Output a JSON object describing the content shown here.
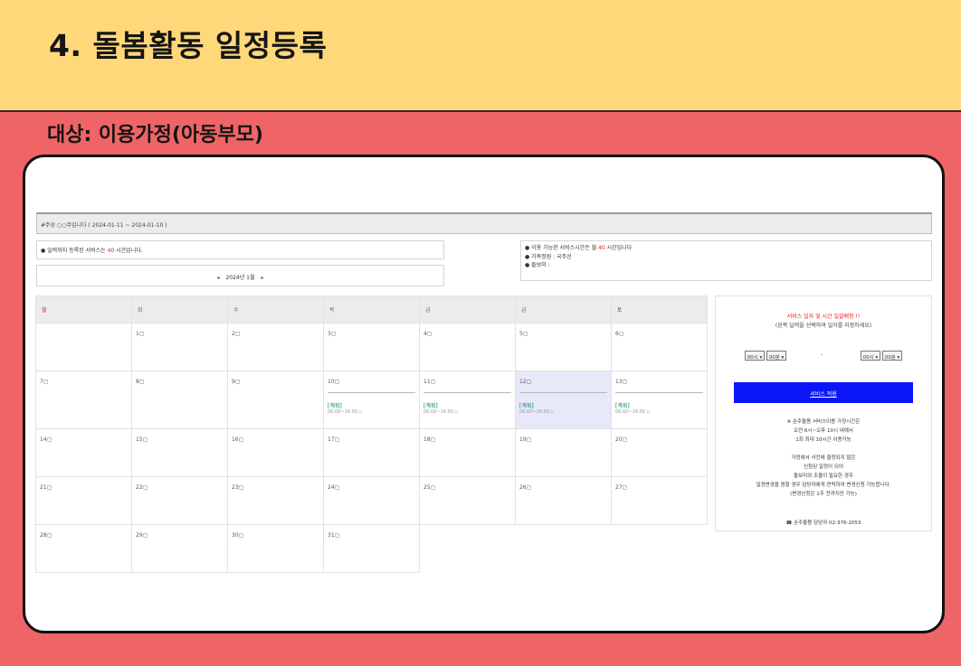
{
  "slide": {
    "title": "4. 돌봄활동 일정등록",
    "subtitle": "대상: 이용가정(아동부모)"
  },
  "screen": {
    "week_bar": "#주상 ○○주입니다 ( 2024-01-11 ~ 2024-01-10 )",
    "notice_left": {
      "prefix": "● 일력까지 등록된 서비스는 ",
      "hours": "40",
      "suffix": " 시간입니다."
    },
    "month_nav": {
      "prev": "◂",
      "label": "2024년 1월",
      "next": "▸"
    },
    "notice_right": {
      "line1_prefix": "● 이용 가능한 서비스시간은 월 ",
      "line1_hours": "40",
      "line1_suffix": " 시간입니다",
      "line2": "● 가족정원 : 국주선",
      "line3": "● 돌보미 :"
    },
    "weekdays": [
      "월",
      "화",
      "수",
      "목",
      "금",
      "금",
      "토"
    ],
    "weeks": [
      [
        {
          "day": ""
        },
        {
          "day": "1▢"
        },
        {
          "day": "2▢"
        },
        {
          "day": "3▢"
        },
        {
          "day": "4▢"
        },
        {
          "day": "5▢"
        },
        {
          "day": "6▢"
        }
      ],
      [
        {
          "day": "7▢"
        },
        {
          "day": "8▢"
        },
        {
          "day": "9▢"
        },
        {
          "day": "10▢",
          "type": "[계획]",
          "time": "06:00~16:00 ▫"
        },
        {
          "day": "11▢",
          "type": "[계획]",
          "time": "06:00~16:00 ▫"
        },
        {
          "day": "12▢",
          "type": "[계획]",
          "time": "06:00~16:00 ▫",
          "selected": true
        },
        {
          "day": "13▢",
          "type": "[계획]",
          "time": "06:00~16:00 ▫"
        }
      ],
      [
        {
          "day": "14▢"
        },
        {
          "day": "15▢"
        },
        {
          "day": "16▢"
        },
        {
          "day": "17▢"
        },
        {
          "day": "18▢"
        },
        {
          "day": "19▢"
        },
        {
          "day": "20▢"
        }
      ],
      [
        {
          "day": "21▢"
        },
        {
          "day": "22▢"
        },
        {
          "day": "23▢"
        },
        {
          "day": "24▢"
        },
        {
          "day": "25▢"
        },
        {
          "day": "26▢"
        },
        {
          "day": "27▢"
        }
      ],
      [
        {
          "day": "28▢"
        },
        {
          "day": "29▢"
        },
        {
          "day": "30▢"
        },
        {
          "day": "31▢"
        }
      ]
    ],
    "side_panel": {
      "title": "서비스 일자 및 시간 일괄배정 !!",
      "subtitle": "(왼쪽 달력을 선택하여 일자를 지정하세요)",
      "start_hour": "00시 ▾",
      "start_min": "00분 ▾",
      "dash": "-",
      "end_hour": "00시 ▾",
      "end_min": "00분 ▾",
      "apply_label": "서비스 적용",
      "notes": [
        "※ 손주돌봄 서비스이용 가정시간은",
        "오전 6시~오후 10시 내에서",
        "1회 최대 10시간 이용가능",
        "",
        "가정에서 사전에 결정되지 않은",
        "신청된 일정이 되어",
        "돌보미와 조율이 필요한 경우",
        "일정변경을 원할 경우 담당자에게 연락하여 변경신청 가능합니다.",
        "(변경신청은 1주 전까지만 가능)"
      ],
      "contact": "☎ 손주돌봄 담당자 02-376-2053"
    }
  },
  "colors": {
    "top_band": "#ffd87a",
    "background": "#ef6466",
    "apply_button": "#0a16f8",
    "selected_day": "#e7e8f8",
    "highlight_text": "#e02020"
  }
}
